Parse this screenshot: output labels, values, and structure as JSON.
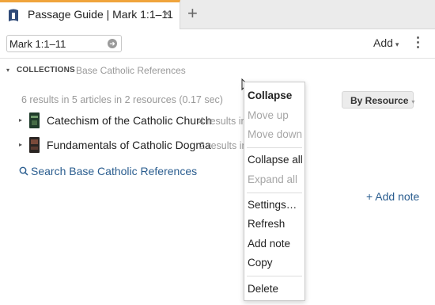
{
  "tab": {
    "title": "Passage Guide | Mark 1:1–11",
    "close_glyph": "×",
    "add_glyph": "+",
    "icon": "guide-book-icon"
  },
  "toolbar": {
    "reference_value": "Mark 1:1–11",
    "go_glyph": "➜",
    "add_label": "Add",
    "add_caret": "▾"
  },
  "collections": {
    "label": "COLLECTIONS",
    "name": "Base Catholic References",
    "caret": "▾"
  },
  "summary_text": "6 results in 5 articles in 2 resources (0.17 sec)",
  "sort": {
    "label": "By Resource",
    "caret": "▾"
  },
  "results": [
    {
      "title": "Catechism of the Catholic Church",
      "count_text": "4 results in",
      "caret": "▸"
    },
    {
      "title": "Fundamentals of Catholic Dogma",
      "count_text": "2 results in",
      "caret": "▸"
    }
  ],
  "search_link": "Search Base Catholic References",
  "add_note_link": "+ Add note",
  "context_menu": {
    "items": [
      {
        "label": "Collapse",
        "state": "bold"
      },
      {
        "label": "Move up",
        "state": "disabled"
      },
      {
        "label": "Move down",
        "state": "disabled"
      },
      {
        "label": "Collapse all",
        "state": "normal"
      },
      {
        "label": "Expand all",
        "state": "disabled"
      },
      {
        "label": "Settings…",
        "state": "normal"
      },
      {
        "label": "Refresh",
        "state": "normal"
      },
      {
        "label": "Add note",
        "state": "normal"
      },
      {
        "label": "Copy",
        "state": "normal"
      },
      {
        "label": "Delete",
        "state": "normal"
      }
    ]
  },
  "colors": {
    "tab_accent": "#f0a43c",
    "link": "#2a5d8f",
    "muted": "#999999"
  }
}
